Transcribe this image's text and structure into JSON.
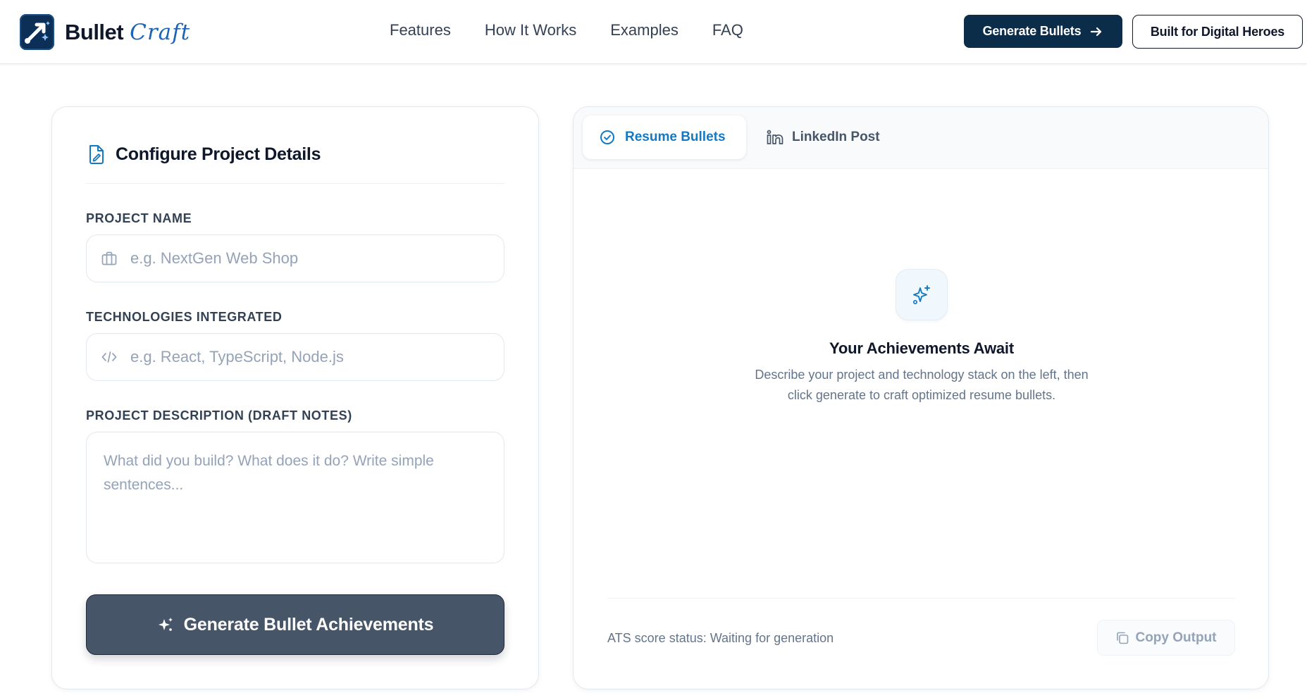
{
  "brand": {
    "name": "Bullet",
    "accent": "Craft"
  },
  "nav": {
    "links": [
      "Features",
      "How It Works",
      "Examples",
      "FAQ"
    ],
    "cta_primary": "Generate Bullets",
    "cta_secondary": "Built for Digital Heroes"
  },
  "config": {
    "title": "Configure Project Details",
    "project_name": {
      "label": "PROJECT NAME",
      "placeholder": "e.g. NextGen Web Shop",
      "value": ""
    },
    "technologies": {
      "label": "TECHNOLOGIES INTEGRATED",
      "placeholder": "e.g. React, TypeScript, Node.js",
      "value": ""
    },
    "description": {
      "label": "PROJECT DESCRIPTION (DRAFT NOTES)",
      "placeholder": "What did you build? What does it do? Write simple sentences...",
      "value": ""
    },
    "generate_button": "Generate Bullet Achievements"
  },
  "output": {
    "tabs": [
      {
        "label": "Resume Bullets",
        "active": true,
        "icon": "check-circle-icon"
      },
      {
        "label": "LinkedIn Post",
        "active": false,
        "icon": "linkedin-icon"
      }
    ],
    "empty_state": {
      "icon": "sparkles-icon",
      "title": "Your Achievements Await",
      "description": "Describe your project and technology stack on the left, then click generate to craft optimized resume bullets."
    },
    "ats_status": "ATS score status: Waiting for generation",
    "copy_button": "Copy Output"
  },
  "colors": {
    "navy": "#0c2d4a",
    "accent_blue": "#1479c4",
    "generate_button_bg": "#475569",
    "text_primary": "#0f172a",
    "text_muted": "#64748b",
    "placeholder": "#94a3b8"
  }
}
